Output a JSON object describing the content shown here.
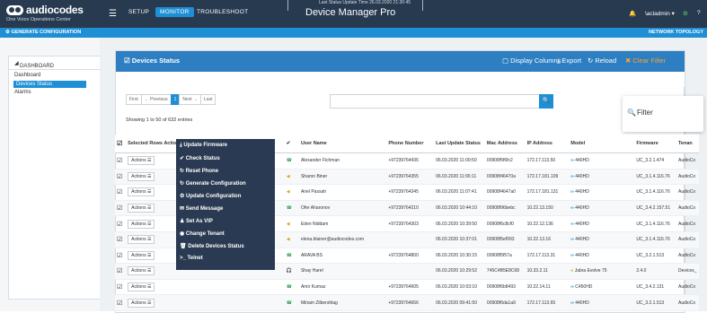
{
  "brand": {
    "name": "audiocodes",
    "tagline": "One Voice Operations Center"
  },
  "nav": {
    "setup": "SETUP",
    "monitor": "MONITOR",
    "troubleshoot": "TROUBLESHOOT"
  },
  "app_title": "Device Manager Pro",
  "ghost_status": "Last Status Update Time  26.03.2020 21:30:45",
  "user": {
    "name": "\\acladmin ▾"
  },
  "subbar": {
    "generate": "GENERATE CONFIGURATION",
    "network": "NETWORK TOPOLOGY"
  },
  "sidebar": {
    "header": "DASHBOARD",
    "items": [
      {
        "label": "Dashboard"
      },
      {
        "label": "Devices Status"
      },
      {
        "label": "Alarms"
      }
    ]
  },
  "panel": {
    "title": "Devices Status",
    "display_columns": "Display Columns",
    "export": "Export",
    "reload": "Reload",
    "clear_filter": "Clear Filter"
  },
  "pager": {
    "first": "First",
    "prev": "← Previous",
    "current": "1",
    "next": "Next →",
    "last": "Last"
  },
  "showing": "Showing 1 to 50 of 632 entries",
  "filter_label": "Filter",
  "table": {
    "headers": {
      "selected": "Selected Rows Actions ☰",
      "user": "User Name",
      "phone": "Phone Number",
      "last_update": "Last Update Status",
      "mac": "Mac Address",
      "ip": "IP Address",
      "model": "Model",
      "firmware": "Firmware",
      "tenant": "Tenan"
    },
    "rows": [
      {
        "actions": "Actions ☰",
        "user": "Alexander Fichman",
        "phone": "+97239764436",
        "last": "06.03.2020 11:09:50",
        "mac": "00908f5f6fc2",
        "ip": "172.17.113.50",
        "model": "440HD",
        "fw": "UC_3.2.1.474",
        "tenant": "AudioCo"
      },
      {
        "actions": "Actions ☰",
        "user": "Sharon Biner",
        "phone": "+97239764355",
        "last": "06.03.2020 11:06:11",
        "mac": "00908f46470a",
        "ip": "172.17.181.109",
        "model": "440HD",
        "fw": "UC_3.1.4.116.76",
        "tenant": "AudioCo"
      },
      {
        "actions": "Actions ☰",
        "user": "Ariel Passah",
        "phone": "+97239764345",
        "last": "06.03.2020 11:07:41",
        "mac": "00908f4647a0",
        "ip": "172.17.181.131",
        "model": "440HD",
        "fw": "UC_3.1.4.116.76",
        "tenant": "AudioCo"
      },
      {
        "actions": "Actions ☰",
        "user": "Ofer Aharonov",
        "phone": "+97239764210",
        "last": "06.03.2020 10:44:10",
        "mac": "00908f96bebc",
        "ip": "10.22.13.150",
        "model": "440HD",
        "fw": "UC_3.4.2.157.51",
        "tenant": "AudioCo"
      },
      {
        "actions": "Actions ☰",
        "user": "Eden Niddam",
        "phone": "+97239764303",
        "last": "06.03.2020 10:39:50",
        "mac": "00908f6c8cf0",
        "ip": "10.22.12.136",
        "model": "440HD",
        "fw": "UC_3.1.4.116.76",
        "tenant": "AudioCo"
      },
      {
        "actions": "Actions ☰",
        "user": "elena.blainer@audiocodes.com",
        "phone": "",
        "last": "06.03.2020 10:37:01",
        "mac": "00908f5ef993",
        "ip": "10.22.13.16",
        "model": "440HD",
        "fw": "UC_3.1.4.116.76",
        "tenant": "AudioCo"
      },
      {
        "actions": "Actions ☰",
        "user": "ARAVA BS",
        "phone": "+97239764800",
        "last": "06.03.2020 10:30:15",
        "mac": "00908f5f57a",
        "ip": "172.17.113.31",
        "model": "440HD",
        "fw": "UC_3.2.1.513",
        "tenant": "AudioCo"
      },
      {
        "actions": "Actions ☰",
        "user": "Shay Harel",
        "phone": "",
        "last": "06.03.2020 10:29:52",
        "mac": "745C4B5E8C68",
        "ip": "10.33.2.11",
        "model": "Jabra Evolve 75",
        "fw": "2.4.0",
        "tenant": "Devices_"
      },
      {
        "actions": "Actions ☰",
        "user": "Amir Kurnaz",
        "phone": "+97239764605",
        "last": "06.03.2020 10:03:10",
        "mac": "00908f6b8493",
        "ip": "10.22.14.11",
        "model": "C450HD",
        "fw": "UC_3.4.2.131",
        "tenant": "AudioCo"
      },
      {
        "actions": "Actions ☰",
        "user": "Miriam Zilbershlag",
        "phone": "+97239764656",
        "last": "06.03.2020 09:41:50",
        "mac": "00908f6da1a9",
        "ip": "172.17.113.65",
        "model": "440HD",
        "fw": "UC_3.2.1.513",
        "tenant": "AudioCo"
      }
    ]
  },
  "dropdown": {
    "items": [
      "Update Firmware",
      "Check Status",
      "Reset Phone",
      "Generate Configuration",
      "Update Configuration",
      "Send Message",
      "Set As VIP",
      "Change Tenant",
      "Delete Devices Status",
      "Telnet"
    ]
  }
}
